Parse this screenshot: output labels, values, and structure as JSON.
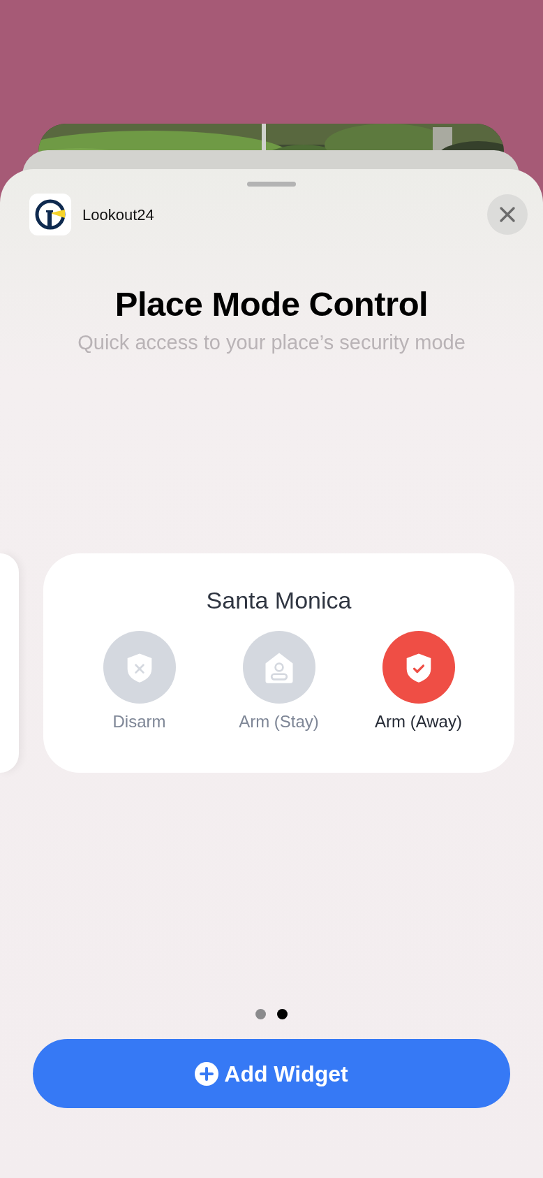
{
  "app": {
    "name": "Lookout24"
  },
  "title": "Place Mode Control",
  "subtitle": "Quick access to your place’s security mode",
  "widget": {
    "place": "Santa Monica",
    "modes": [
      {
        "label": "Disarm",
        "kind": "disarm",
        "selected": false
      },
      {
        "label": "Arm (Stay)",
        "kind": "stay",
        "selected": false
      },
      {
        "label": "Arm (Away)",
        "kind": "away",
        "selected": true
      }
    ]
  },
  "pages": [
    {
      "selected": false
    },
    {
      "selected": true
    }
  ],
  "button": {
    "label": "Add Widget"
  }
}
